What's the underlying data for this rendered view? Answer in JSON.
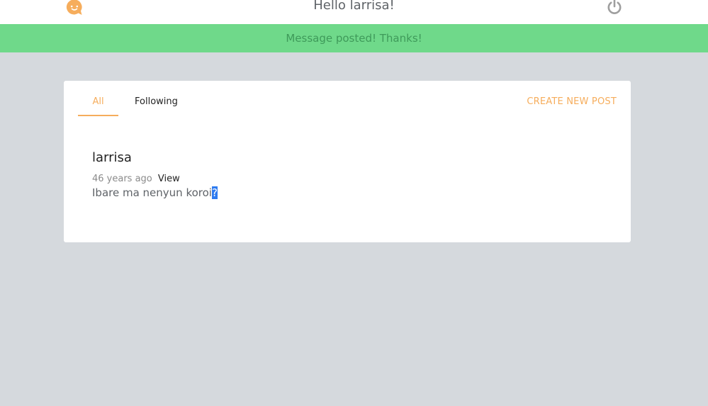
{
  "header": {
    "greeting": "Hello larrisa!",
    "logo_icon": "chat-bubble-face-icon",
    "power_icon": "power-icon",
    "accent": "#f6ad5c"
  },
  "flash": {
    "message": "Message posted! Thanks!",
    "color": "#6fd98a"
  },
  "tabs": [
    {
      "label": "All",
      "active": true
    },
    {
      "label": "Following",
      "active": false
    }
  ],
  "create_label": "CREATE NEW POST",
  "posts": [
    {
      "author": "larrisa",
      "time": "46 years ago",
      "view_label": "View",
      "body_main": "Ibare ma nenyun koroi",
      "body_selected": "?"
    }
  ]
}
